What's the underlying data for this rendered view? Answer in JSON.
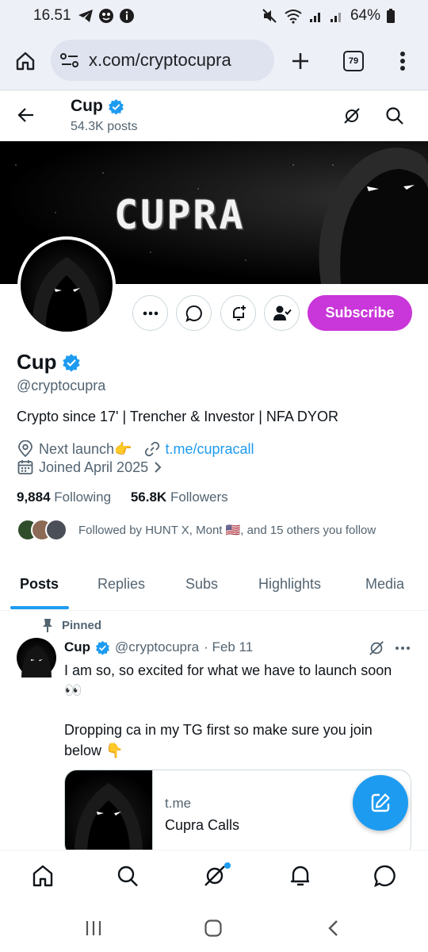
{
  "status_bar": {
    "time": "16.51",
    "battery": "64%"
  },
  "browser": {
    "url": "x.com/cryptocupra",
    "tab_count": "79"
  },
  "profile_header": {
    "name": "Cup",
    "posts_count": "54.3K posts"
  },
  "banner": {
    "text": "CUPRA"
  },
  "actions": {
    "subscribe_label": "Subscribe"
  },
  "profile": {
    "name": "Cup",
    "handle": "@cryptocupra",
    "bio": "Crypto since 17' | Trencher & Investor | NFA DYOR",
    "next_launch": "Next launch👉",
    "link": "t.me/cupracall",
    "joined": "Joined April 2025",
    "following_count": "9,884",
    "following_label": "Following",
    "followers_count": "56.8K",
    "followers_label": "Followers",
    "followed_by": "Followed by HUNT X, Mont 🇺🇸, and 15 others you follow"
  },
  "tabs": [
    {
      "label": "Posts",
      "active": true
    },
    {
      "label": "Replies"
    },
    {
      "label": "Subs"
    },
    {
      "label": "Highlights"
    },
    {
      "label": "Media"
    }
  ],
  "pinned_post": {
    "pinned_label": "Pinned",
    "author_name": "Cup",
    "author_handle": "@cryptocupra",
    "date": "· Feb 11",
    "paragraph_1": "I am so, so excited for what we have to launch soon 👀",
    "paragraph_2": "Dropping ca in my TG first so make sure you join below 👇",
    "card_domain": "t.me",
    "card_title": "Cupra Calls"
  },
  "colors": {
    "accent_blue": "#1d9bf0",
    "subscribe_purple": "#c936d9",
    "secondary_text": "#536471"
  }
}
